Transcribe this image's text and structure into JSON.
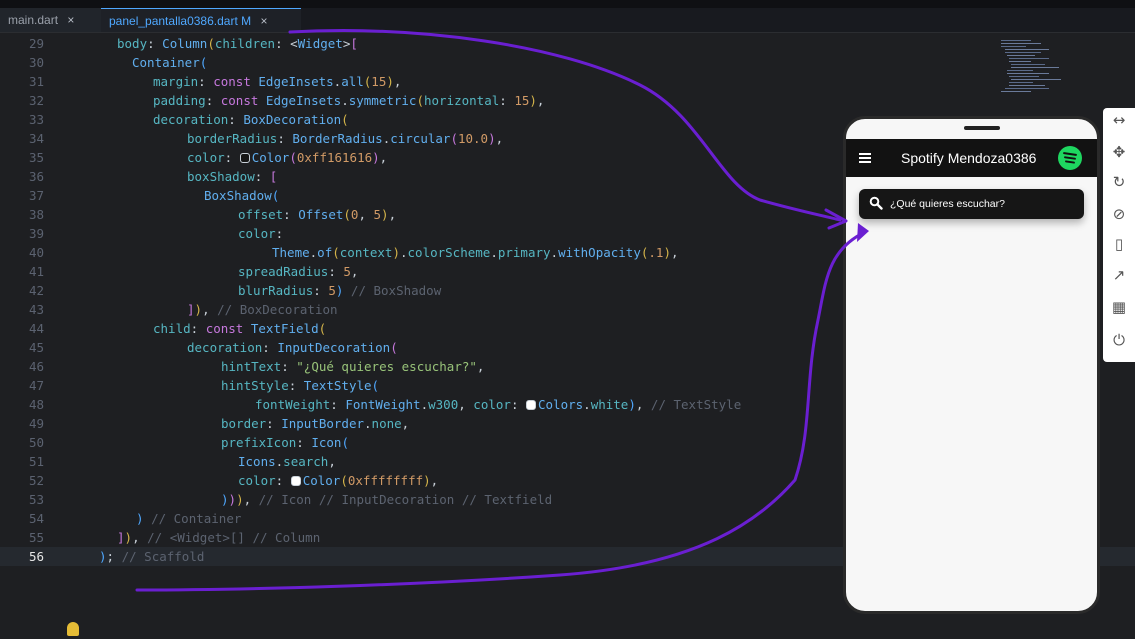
{
  "tabs": [
    {
      "label": "main.dart",
      "close": "×"
    },
    {
      "label": "panel_pantalla0386.dart M",
      "close": "×"
    }
  ],
  "code": {
    "lines": [
      {
        "n": "29",
        "text": "body: Column(children: <Widget>["
      },
      {
        "n": "30",
        "text": "Container("
      },
      {
        "n": "31",
        "text": "margin: const EdgeInsets.all(15),"
      },
      {
        "n": "32",
        "text": "padding: const EdgeInsets.symmetric(horizontal: 15),"
      },
      {
        "n": "33",
        "text": "decoration: BoxDecoration("
      },
      {
        "n": "34",
        "text": "borderRadius: BorderRadius.circular(10.0),"
      },
      {
        "n": "35",
        "text": "color: Color(0xff161616),"
      },
      {
        "n": "36",
        "text": "boxShadow: ["
      },
      {
        "n": "37",
        "text": "BoxShadow("
      },
      {
        "n": "38",
        "text": "offset: Offset(0, 5),"
      },
      {
        "n": "39",
        "text": "color:"
      },
      {
        "n": "40",
        "text": "Theme.of(context).colorScheme.primary.withOpacity(.1),"
      },
      {
        "n": "41",
        "text": "spreadRadius: 5,"
      },
      {
        "n": "42",
        "text": "blurRadius: 5) // BoxShadow"
      },
      {
        "n": "43",
        "text": "]), // BoxDecoration"
      },
      {
        "n": "44",
        "text": "child: const TextField("
      },
      {
        "n": "45",
        "text": "decoration: InputDecoration("
      },
      {
        "n": "46",
        "text": "hintText: \"¿Qué quieres escuchar?\","
      },
      {
        "n": "47",
        "text": "hintStyle: TextStyle("
      },
      {
        "n": "48",
        "text": "fontWeight: FontWeight.w300, color: Colors.white), // TextStyle"
      },
      {
        "n": "49",
        "text": "border: InputBorder.none,"
      },
      {
        "n": "50",
        "text": "prefixIcon: Icon("
      },
      {
        "n": "51",
        "text": "Icons.search,"
      },
      {
        "n": "52",
        "text": "color: Color(0xffffffff),"
      },
      {
        "n": "53",
        "text": "))), // Icon // InputDecoration // Textfield"
      },
      {
        "n": "54",
        "text": ") // Container"
      },
      {
        "n": "55",
        "text": "]), // <Widget>[] // Column"
      },
      {
        "n": "56",
        "text": "); // Scaffold"
      }
    ]
  },
  "phone": {
    "title": "Spotify Mendoza0386",
    "search_hint": "¿Qué quieres escuchar?"
  },
  "toolbar": {
    "icons": [
      "resize-horizontal-icon",
      "move-icon",
      "rotate-icon",
      "no-rotate-icon",
      "phone-screen-icon",
      "open-external-icon",
      "qr-code-icon",
      "power-icon"
    ]
  },
  "colors": {
    "editor_bg": "#1e1f22",
    "accent_tab": "#4fa8ff",
    "annotation": "#6a1fd1",
    "spotify_green": "#1ed760",
    "search_bg": "#161616"
  }
}
